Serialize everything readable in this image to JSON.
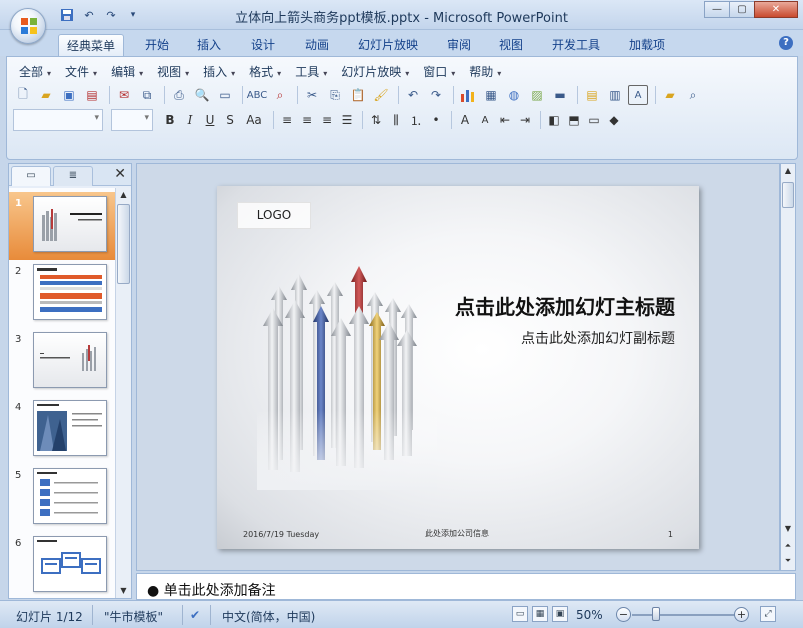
{
  "window": {
    "title": "立体向上箭头商务ppt模板.pptx - Microsoft PowerPoint"
  },
  "colors": {
    "selected_thumb": "#e88b3a",
    "ribbon_bg": "#dce7f4",
    "title_text": "#1e395b",
    "arrow_red": "#b63a3a",
    "arrow_blue": "#3d5ea8",
    "arrow_gold": "#d9b24a"
  },
  "icons": {
    "quick_access": [
      "save-icon",
      "undo-icon",
      "redo-icon",
      "customize-icon"
    ],
    "window_controls": [
      "minimize-icon",
      "maximize-icon",
      "close-icon"
    ]
  },
  "ribbon": {
    "tabs": [
      {
        "label": "经典菜单",
        "active": true
      },
      {
        "label": "开始"
      },
      {
        "label": "插入"
      },
      {
        "label": "设计"
      },
      {
        "label": "动画"
      },
      {
        "label": "幻灯片放映"
      },
      {
        "label": "审阅"
      },
      {
        "label": "视图"
      },
      {
        "label": "开发工具"
      },
      {
        "label": "加载项"
      }
    ],
    "menus": [
      "全部",
      "文件",
      "编辑",
      "视图",
      "插入",
      "格式",
      "工具",
      "幻灯片放映",
      "窗口",
      "帮助"
    ]
  },
  "thumbnails": [
    {
      "num": "1",
      "selected": true
    },
    {
      "num": "2"
    },
    {
      "num": "3"
    },
    {
      "num": "4"
    },
    {
      "num": "5"
    },
    {
      "num": "6"
    }
  ],
  "slide": {
    "logo": "LOGO",
    "title": "点击此处添加幻灯主标题",
    "subtitle": "点击此处添加幻灯副标题",
    "footer_date": "2016/7/19  Tuesday",
    "footer_center": "此处添加公司信息",
    "footer_number": "1"
  },
  "notes": {
    "text": "● 单击此处添加备注"
  },
  "status": {
    "slide_counter": "幻灯片 1/12",
    "theme": "\"牛市模板\"",
    "language": "中文(简体，中国)",
    "zoom": "50%"
  }
}
